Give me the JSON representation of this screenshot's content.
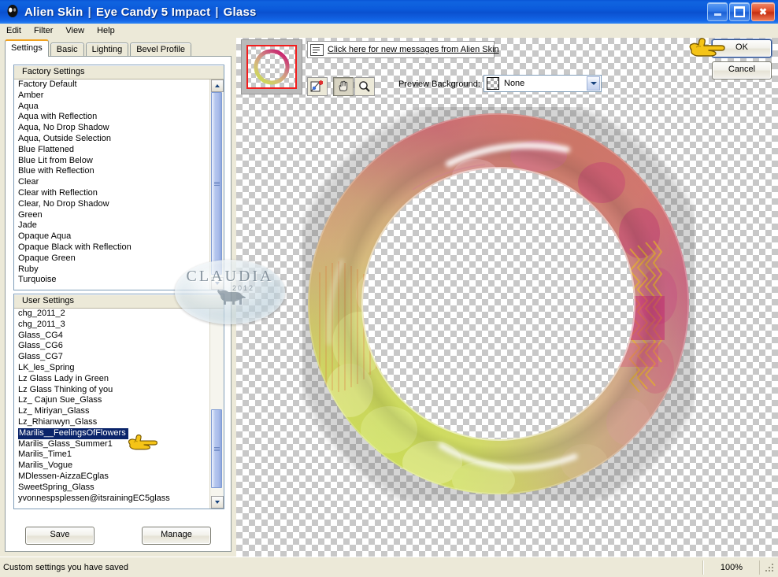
{
  "window": {
    "title_parts": [
      "Alien Skin",
      "Eye Candy 5 Impact",
      "Glass"
    ],
    "title_full": "Alien Skin | Eye Candy 5 Impact | Glass",
    "icon": "alien-head-icon",
    "minimize_label": "Minimize",
    "maximize_label": "Maximize",
    "close_label": "Close",
    "accent_titlebar": "#0b5ada"
  },
  "menu": {
    "items": [
      {
        "label": "Edit"
      },
      {
        "label": "Filter"
      },
      {
        "label": "View"
      },
      {
        "label": "Help"
      }
    ]
  },
  "tabs": [
    {
      "label": "Settings",
      "active": true
    },
    {
      "label": "Basic",
      "active": false
    },
    {
      "label": "Lighting",
      "active": false
    },
    {
      "label": "Bevel Profile",
      "active": false
    }
  ],
  "factory_settings": {
    "header": "Factory Settings",
    "items": [
      "Factory Default",
      "Amber",
      "Aqua",
      "Aqua with Reflection",
      "Aqua, No Drop Shadow",
      "Aqua, Outside Selection",
      "Blue Flattened",
      "Blue Lit from Below",
      "Blue with Reflection",
      "Clear",
      "Clear with Reflection",
      "Clear, No Drop Shadow",
      "Green",
      "Jade",
      "Opaque Aqua",
      "Opaque Black with Reflection",
      "Opaque Green",
      "Ruby",
      "Turquoise"
    ]
  },
  "user_settings": {
    "header": "User Settings",
    "selected": "Marilis__FeelingsOfFlowers",
    "items": [
      "chg_2011_2",
      "chg_2011_3",
      "Glass_CG4",
      "Glass_CG6",
      "Glass_CG7",
      "LK_les_Spring",
      "Lz Glass Lady in Green",
      "Lz Glass Thinking of you",
      "Lz_ Cajun Sue_Glass",
      "Lz_ Miriyan_Glass",
      "Lz_Rhianwyn_Glass",
      "Marilis__FeelingsOfFlowers",
      "Marilis_Glass_Summer1",
      "Marilis_Time1",
      "Marilis_Vogue",
      "MDlessen-AizzaECglas",
      "SweetSpring_Glass",
      "yvonnespsplessen@itsrainingEC5glass"
    ]
  },
  "panel_buttons": {
    "save": "Save",
    "manage": "Manage"
  },
  "message_bar": {
    "icon": "message-envelope-icon",
    "text": "Click here for new messages from Alien Skin"
  },
  "toolbar": {
    "buttons": [
      {
        "name": "edit-image-tool",
        "label": "Edit Image"
      },
      {
        "name": "pan-hand-tool",
        "label": "Pan",
        "pressed": true
      },
      {
        "name": "zoom-magnifier-tool",
        "label": "Zoom"
      }
    ]
  },
  "preview_background": {
    "label": "Preview Background:",
    "value": "None",
    "swatch": "checkerboard-transparent",
    "options": [
      "None"
    ]
  },
  "dialog_buttons": {
    "ok": "OK",
    "cancel": "Cancel"
  },
  "status_bar": {
    "message": "Custom settings you have saved",
    "zoom": "100%"
  },
  "watermark": {
    "name": "CLAUDIA",
    "year": "2012"
  },
  "preview": {
    "thumbnail_alt": "glass ring thumbnail",
    "main_alt": "glass ring preview"
  },
  "pointers": [
    {
      "name": "hand-pointer-ok",
      "target": "OK"
    },
    {
      "name": "hand-pointer-selected-preset",
      "target": "Marilis__FeelingsOfFlowers"
    }
  ]
}
